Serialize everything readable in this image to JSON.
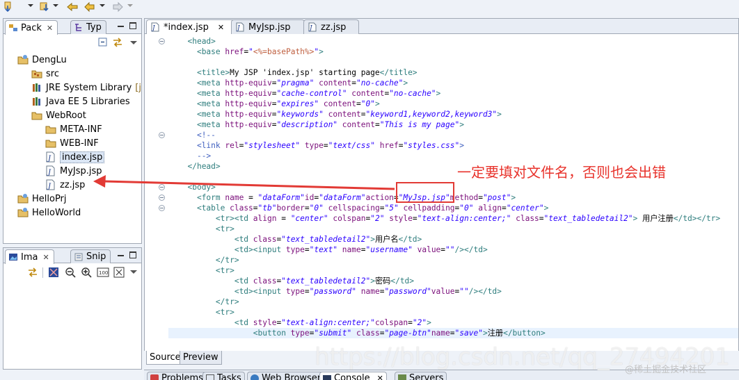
{
  "toolbar": {
    "items": [
      "arrow-down-icon",
      "package-arrow-icon",
      "next-annotation-icon",
      "back-icon",
      "forward-icon"
    ]
  },
  "package_view": {
    "tabs": [
      {
        "label": "Pack",
        "active": true
      },
      {
        "label": "Typ",
        "active": false
      }
    ],
    "tree": [
      {
        "label": "DengLu",
        "icon": "project-icon",
        "depth": 1
      },
      {
        "label": "src",
        "icon": "source-folder-icon",
        "depth": 2
      },
      {
        "label": "JRE System Library",
        "suffix": "[jdk",
        "icon": "library-icon",
        "depth": 2
      },
      {
        "label": "Java EE 5 Libraries",
        "icon": "library-icon",
        "depth": 2
      },
      {
        "label": "WebRoot",
        "icon": "folder-icon",
        "depth": 2
      },
      {
        "label": "META-INF",
        "icon": "folder-icon",
        "depth": 3
      },
      {
        "label": "WEB-INF",
        "icon": "folder-icon",
        "depth": 3
      },
      {
        "label": "index.jsp",
        "icon": "jsp-file-icon",
        "depth": 3,
        "selected": true
      },
      {
        "label": "MyJsp.jsp",
        "icon": "jsp-file-icon",
        "depth": 3
      },
      {
        "label": "zz.jsp",
        "icon": "jsp-file-icon",
        "depth": 3
      },
      {
        "label": "HelloPrj",
        "icon": "project-icon",
        "depth": 1
      },
      {
        "label": "HelloWorld",
        "icon": "project-icon",
        "depth": 1
      }
    ]
  },
  "image_view": {
    "tabs": [
      {
        "label": "Ima",
        "active": true
      },
      {
        "label": "Snip",
        "active": false
      }
    ]
  },
  "editor": {
    "tabs": [
      {
        "label": "*index.jsp",
        "active": true
      },
      {
        "label": "MyJsp.jsp",
        "active": false
      },
      {
        "label": "zz.jsp",
        "active": false
      }
    ],
    "lines": [
      {
        "fold": true,
        "indent": "  ",
        "parts": [
          [
            "tag",
            "<head>"
          ]
        ]
      },
      {
        "indent": "    ",
        "parts": [
          [
            "tag",
            "<base "
          ],
          [
            "attr",
            "href"
          ],
          [
            "txt",
            "="
          ],
          [
            "val",
            "\""
          ],
          [
            "jsp",
            "<%=basePath%>"
          ],
          [
            "val",
            "\""
          ],
          [
            "tag",
            ">"
          ]
        ]
      },
      {
        "indent": "",
        "parts": []
      },
      {
        "indent": "    ",
        "parts": [
          [
            "tag",
            "<title>"
          ],
          [
            "txt",
            "My JSP 'index.jsp' starting page"
          ],
          [
            "tag",
            "</title>"
          ]
        ]
      },
      {
        "indent": "    ",
        "parts": [
          [
            "tag",
            "<meta "
          ],
          [
            "attr",
            "http-equiv"
          ],
          [
            "txt",
            "="
          ],
          [
            "val",
            "\"pragma\""
          ],
          [
            "txt",
            " "
          ],
          [
            "attr",
            "content"
          ],
          [
            "txt",
            "="
          ],
          [
            "val",
            "\"no-cache\""
          ],
          [
            "tag",
            ">"
          ]
        ]
      },
      {
        "indent": "    ",
        "parts": [
          [
            "tag",
            "<meta "
          ],
          [
            "attr",
            "http-equiv"
          ],
          [
            "txt",
            "="
          ],
          [
            "val",
            "\"cache-control\""
          ],
          [
            "txt",
            " "
          ],
          [
            "attr",
            "content"
          ],
          [
            "txt",
            "="
          ],
          [
            "val",
            "\"no-cache\""
          ],
          [
            "tag",
            ">"
          ]
        ]
      },
      {
        "indent": "    ",
        "parts": [
          [
            "tag",
            "<meta "
          ],
          [
            "attr",
            "http-equiv"
          ],
          [
            "txt",
            "="
          ],
          [
            "val",
            "\"expires\""
          ],
          [
            "txt",
            " "
          ],
          [
            "attr",
            "content"
          ],
          [
            "txt",
            "="
          ],
          [
            "val",
            "\"0\""
          ],
          [
            "tag",
            ">"
          ]
        ]
      },
      {
        "indent": "    ",
        "parts": [
          [
            "tag",
            "<meta "
          ],
          [
            "attr",
            "http-equiv"
          ],
          [
            "txt",
            "="
          ],
          [
            "val",
            "\"keywords\""
          ],
          [
            "txt",
            " "
          ],
          [
            "attr",
            "content"
          ],
          [
            "txt",
            "="
          ],
          [
            "val",
            "\"keyword1,keyword2,keyword3\""
          ],
          [
            "tag",
            ">"
          ]
        ]
      },
      {
        "indent": "    ",
        "parts": [
          [
            "tag",
            "<meta "
          ],
          [
            "attr",
            "http-equiv"
          ],
          [
            "txt",
            "="
          ],
          [
            "val",
            "\"description\""
          ],
          [
            "txt",
            " "
          ],
          [
            "attr",
            "content"
          ],
          [
            "txt",
            "="
          ],
          [
            "val",
            "\"This is my page\""
          ],
          [
            "tag",
            ">"
          ]
        ]
      },
      {
        "fold": true,
        "indent": "    ",
        "parts": [
          [
            "cmt",
            "<!--"
          ]
        ]
      },
      {
        "indent": "    ",
        "parts": [
          [
            "cmt",
            "<link "
          ],
          [
            "attr",
            "rel"
          ],
          [
            "txt",
            "="
          ],
          [
            "val",
            "\"stylesheet\""
          ],
          [
            "txt",
            " "
          ],
          [
            "attr",
            "type"
          ],
          [
            "txt",
            "="
          ],
          [
            "val",
            "\"text/css\""
          ],
          [
            "txt",
            " "
          ],
          [
            "attr",
            "href"
          ],
          [
            "txt",
            "="
          ],
          [
            "val",
            "\"styles.css\""
          ],
          [
            "cmt",
            ">"
          ]
        ]
      },
      {
        "indent": "    ",
        "parts": [
          [
            "cmt",
            "-->"
          ]
        ]
      },
      {
        "indent": "  ",
        "parts": [
          [
            "tag",
            "</head>"
          ]
        ]
      },
      {
        "indent": "",
        "parts": []
      },
      {
        "fold": true,
        "indent": "  ",
        "parts": [
          [
            "tag",
            "<body>"
          ]
        ]
      },
      {
        "fold": true,
        "indent": "    ",
        "parts": [
          [
            "tag",
            "<form "
          ],
          [
            "attr",
            "name"
          ],
          [
            "txt",
            " = "
          ],
          [
            "val",
            "\"dataForm\""
          ],
          [
            "attr",
            "id"
          ],
          [
            "txt",
            "="
          ],
          [
            "val",
            "\"dataForm\""
          ],
          [
            "attr",
            "action"
          ],
          [
            "txt",
            "="
          ],
          [
            "val",
            "\"MyJsp.jsp\""
          ],
          [
            "attr",
            "method"
          ],
          [
            "txt",
            "="
          ],
          [
            "val",
            "\"post\""
          ],
          [
            "tag",
            ">"
          ]
        ]
      },
      {
        "fold": true,
        "indent": "    ",
        "parts": [
          [
            "tag",
            "<table "
          ],
          [
            "attr",
            "class"
          ],
          [
            "txt",
            "="
          ],
          [
            "val",
            "\"tb\""
          ],
          [
            "attr",
            "border"
          ],
          [
            "txt",
            "="
          ],
          [
            "val",
            "\"0\""
          ],
          [
            "txt",
            " "
          ],
          [
            "attr",
            "cellspacing"
          ],
          [
            "txt",
            "="
          ],
          [
            "val",
            "\"5\""
          ],
          [
            "txt",
            " "
          ],
          [
            "attr",
            "cellpadding"
          ],
          [
            "txt",
            "="
          ],
          [
            "val",
            "\"0\""
          ],
          [
            "txt",
            " "
          ],
          [
            "attr",
            "align"
          ],
          [
            "txt",
            "="
          ],
          [
            "val",
            "\"center\""
          ],
          [
            "tag",
            ">"
          ]
        ]
      },
      {
        "indent": "        ",
        "parts": [
          [
            "tag",
            "<tr><td "
          ],
          [
            "attr",
            "align"
          ],
          [
            "txt",
            " = "
          ],
          [
            "val",
            "\"center\""
          ],
          [
            "txt",
            " "
          ],
          [
            "attr",
            "colspan"
          ],
          [
            "txt",
            "="
          ],
          [
            "val",
            "\"2\""
          ],
          [
            "txt",
            " "
          ],
          [
            "attr",
            "style"
          ],
          [
            "txt",
            "="
          ],
          [
            "val",
            "\"text-align:center;\""
          ],
          [
            "txt",
            " "
          ],
          [
            "attr",
            "class"
          ],
          [
            "txt",
            "="
          ],
          [
            "val",
            "\"text_tabledetail2\""
          ],
          [
            "tag",
            ">"
          ],
          [
            "txt",
            " 用户注册"
          ],
          [
            "tag",
            "</td></tr>"
          ]
        ]
      },
      {
        "indent": "        ",
        "parts": [
          [
            "tag",
            "<tr>"
          ]
        ]
      },
      {
        "indent": "            ",
        "parts": [
          [
            "tag",
            "<td "
          ],
          [
            "attr",
            "class"
          ],
          [
            "txt",
            "="
          ],
          [
            "val",
            "\"text_tabledetail2\""
          ],
          [
            "tag",
            ">"
          ],
          [
            "txt",
            "用户名"
          ],
          [
            "tag",
            "</td>"
          ]
        ]
      },
      {
        "indent": "            ",
        "parts": [
          [
            "tag",
            "<td><input "
          ],
          [
            "attr",
            "type"
          ],
          [
            "txt",
            "="
          ],
          [
            "val",
            "\"text\""
          ],
          [
            "txt",
            " "
          ],
          [
            "attr",
            "name"
          ],
          [
            "txt",
            "="
          ],
          [
            "val",
            "\"username\""
          ],
          [
            "txt",
            " "
          ],
          [
            "attr",
            "value"
          ],
          [
            "txt",
            "="
          ],
          [
            "val",
            "\"\""
          ],
          [
            "tag",
            "/></td>"
          ]
        ]
      },
      {
        "indent": "        ",
        "parts": [
          [
            "tag",
            "</tr>"
          ]
        ]
      },
      {
        "indent": "        ",
        "parts": [
          [
            "tag",
            "<tr>"
          ]
        ]
      },
      {
        "indent": "            ",
        "parts": [
          [
            "tag",
            "<td "
          ],
          [
            "attr",
            "class"
          ],
          [
            "txt",
            "="
          ],
          [
            "val",
            "\"text_tabledetail2\""
          ],
          [
            "tag",
            ">"
          ],
          [
            "txt",
            "密码"
          ],
          [
            "tag",
            "</td>"
          ]
        ]
      },
      {
        "indent": "            ",
        "parts": [
          [
            "tag",
            "<td><input "
          ],
          [
            "attr",
            "type"
          ],
          [
            "txt",
            "="
          ],
          [
            "val",
            "\"password\""
          ],
          [
            "txt",
            " "
          ],
          [
            "attr",
            "name"
          ],
          [
            "txt",
            "="
          ],
          [
            "val",
            "\"password\""
          ],
          [
            "attr",
            "value"
          ],
          [
            "txt",
            "="
          ],
          [
            "val",
            "\"\""
          ],
          [
            "tag",
            "/></td>"
          ]
        ]
      },
      {
        "indent": "        ",
        "parts": [
          [
            "tag",
            "</tr>"
          ]
        ]
      },
      {
        "indent": "        ",
        "parts": [
          [
            "tag",
            "<tr>"
          ]
        ]
      },
      {
        "indent": "            ",
        "parts": [
          [
            "tag",
            "<td "
          ],
          [
            "attr",
            "style"
          ],
          [
            "txt",
            "="
          ],
          [
            "val",
            "\"text-align:center;\""
          ],
          [
            "attr",
            "colspan"
          ],
          [
            "txt",
            "="
          ],
          [
            "val",
            "\"2\""
          ],
          [
            "tag",
            ">"
          ]
        ]
      },
      {
        "current": true,
        "indent": "                ",
        "parts": [
          [
            "tag",
            "<button "
          ],
          [
            "attr",
            "type"
          ],
          [
            "txt",
            "="
          ],
          [
            "val",
            "\"submit\""
          ],
          [
            "txt",
            " "
          ],
          [
            "attr",
            "class"
          ],
          [
            "txt",
            "="
          ],
          [
            "val",
            "\"page-btn\""
          ],
          [
            "attr",
            "name"
          ],
          [
            "txt",
            "="
          ],
          [
            "val",
            "\"save\""
          ],
          [
            "tag",
            ">"
          ],
          [
            "txt",
            "注册"
          ],
          [
            "tag",
            "</button>"
          ]
        ]
      }
    ],
    "source_tabs": [
      {
        "label": "Source",
        "active": true
      },
      {
        "label": "Preview",
        "active": false
      }
    ]
  },
  "bottom_tabs": [
    {
      "label": "Problems"
    },
    {
      "label": "Tasks"
    },
    {
      "label": "Web Browser"
    },
    {
      "label": "Console"
    },
    {
      "label": "Servers"
    }
  ],
  "annotation": {
    "text": "一定要填对文件名，否则也会出错",
    "color": "#e8322b"
  },
  "watermark": {
    "text": "https://blog.csdn.net/qq_27494201",
    "secondary": "@稀土掘金技术社区"
  }
}
